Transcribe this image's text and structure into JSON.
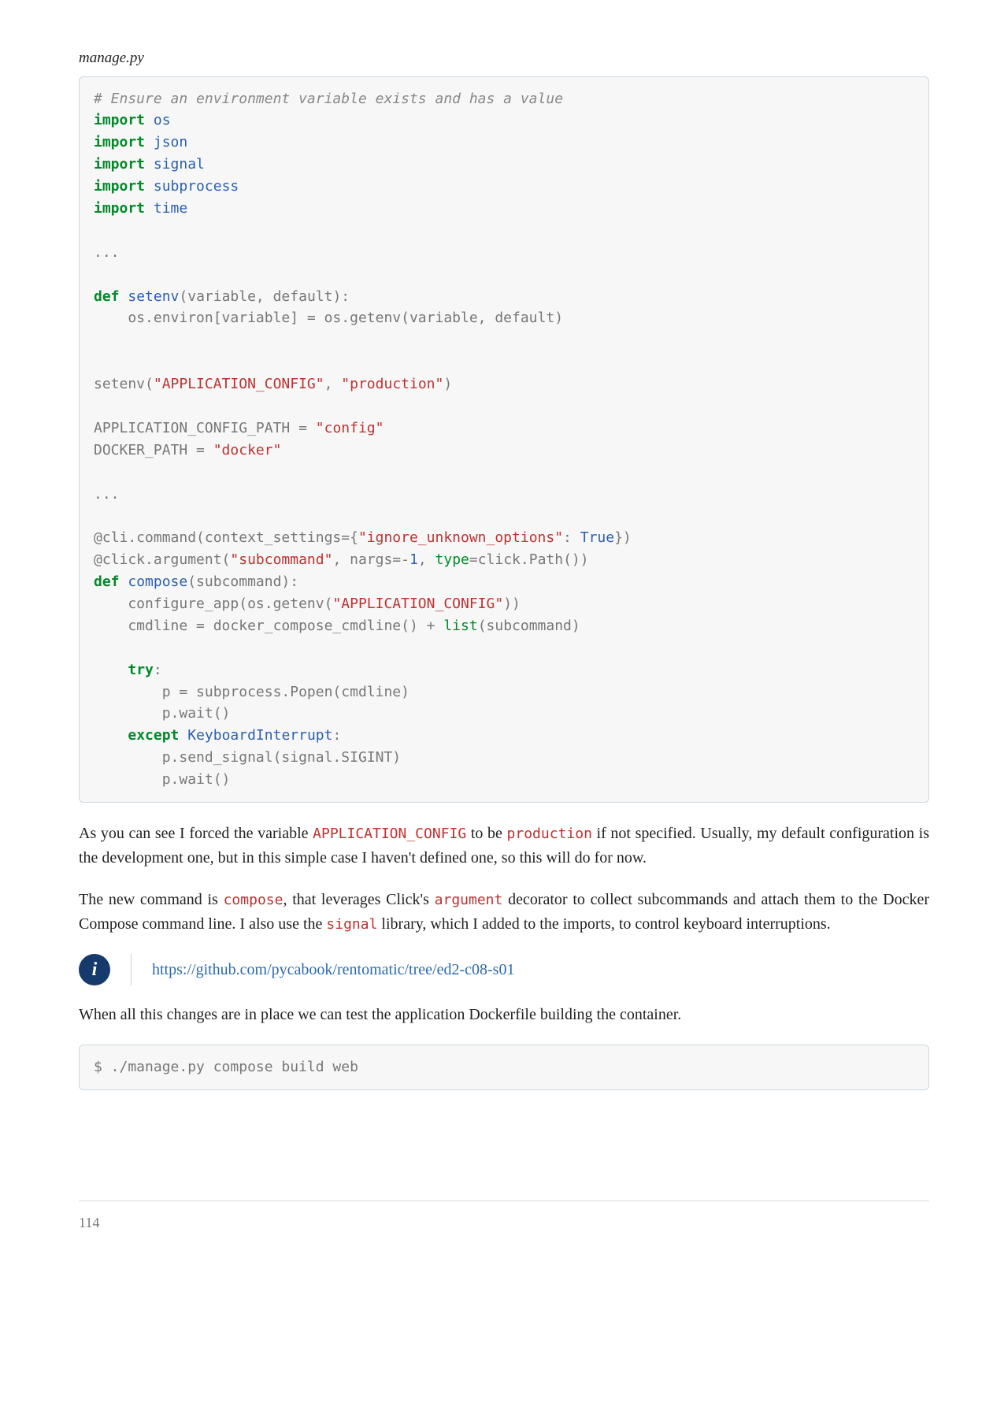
{
  "page_number": "114",
  "code_label": "manage.py",
  "code": {
    "c1": "# Ensure an environment variable exists and has a value",
    "kw_import": "import",
    "os": "os",
    "json": "json",
    "signal": "signal",
    "subprocess": "subprocess",
    "time": "time",
    "dots": "...",
    "kw_def": "def",
    "fn_setenv": "setenv",
    "params_setenv": "(variable, default):",
    "body_setenv": "    os.environ[variable] = os.getenv(variable, default)",
    "call_setenv_pre": "setenv(",
    "str_appcfg": "\"APPLICATION_CONFIG\"",
    "comma_sp": ", ",
    "str_prod": "\"production\"",
    "close_paren": ")",
    "appcfg_path_pre": "APPLICATION_CONFIG_PATH = ",
    "str_config": "\"config\"",
    "docker_path_pre": "DOCKER_PATH = ",
    "str_docker": "\"docker\"",
    "deco1_pre": "@cli.command(context_settings={",
    "str_ignore": "\"ignore_unknown_options\"",
    "colon_sp": ": ",
    "true": "True",
    "deco1_suf": "})",
    "deco2_pre": "@click.argument(",
    "str_subcmd": "\"subcommand\"",
    "nargs_pre": ", nargs=-",
    "one": "1",
    "type_pre": ", ",
    "bi_type": "type",
    "type_suf": "=click.Path())",
    "fn_compose": "compose",
    "params_compose": "(subcommand):",
    "compose_l1_pre": "    configure_app(os.getenv(",
    "compose_l1_suf": "))",
    "compose_l2_pre": "    cmdline = docker_compose_cmdline() + ",
    "bi_list": "list",
    "compose_l2_suf": "(subcommand)",
    "kw_try": "try",
    "colon": ":",
    "try_l1": "        p = subprocess.Popen(cmdline)",
    "try_l2": "        p.wait()",
    "kw_except": "except",
    "exc_kbd": "KeyboardInterrupt",
    "exc_l1": "        p.send_signal(signal.SIGINT)",
    "exc_l2": "        p.wait()",
    "indent4": "    "
  },
  "para1": {
    "t1": "As you can see I forced the variable ",
    "c1": "APPLICATION_CONFIG",
    "t2": " to be ",
    "c2": "production",
    "t3": " if not specified. Usually, my default configuration is the development one, but in this simple case I haven't defined one, so this will do for now."
  },
  "para2": {
    "t1": "The new command is ",
    "c1": "compose",
    "t2": ", that leverages Click's ",
    "c2": "argument",
    "t3": " decorator to collect subcommands and attach them to the Docker Compose command line. I also use the ",
    "c3": "signal",
    "t4": " library, which I added to the imports, to control keyboard interruptions."
  },
  "info": {
    "icon_glyph": "i",
    "link_text": "https://github.com/pycabook/rentomatic/tree/ed2-c08-s01"
  },
  "para3": {
    "t1": "When all this changes are in place we can test the application Dockerfile building the container."
  },
  "shell": {
    "line": "$ ./manage.py compose build web"
  }
}
